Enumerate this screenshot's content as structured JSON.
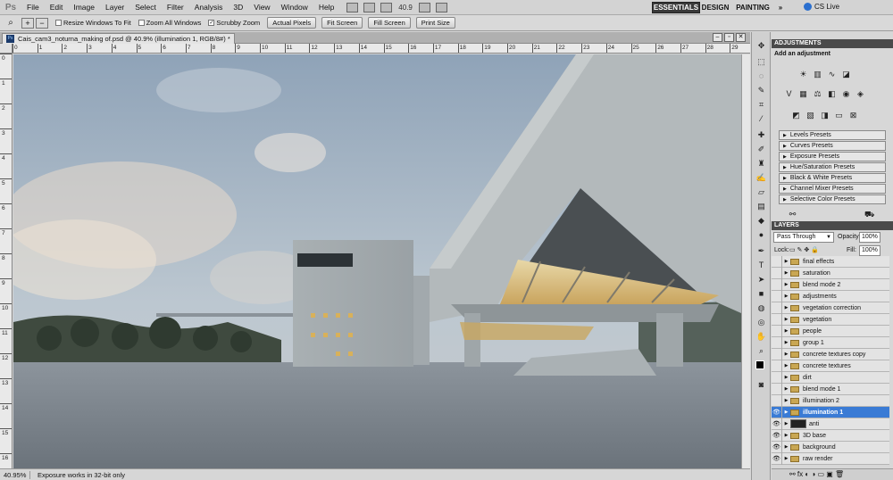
{
  "app": {
    "logo": "Ps"
  },
  "menu": [
    "File",
    "Edit",
    "Image",
    "Layer",
    "Select",
    "Filter",
    "Analysis",
    "3D",
    "View",
    "Window",
    "Help"
  ],
  "app_bar": {
    "zoom": "40.9",
    "workspaces": [
      "ESSENTIALS",
      "DESIGN",
      "PAINTING",
      "»"
    ],
    "cs_live": "CS Live"
  },
  "options": {
    "resize_windows": {
      "label": "Resize Windows To Fit",
      "checked": false
    },
    "zoom_all": {
      "label": "Zoom All Windows",
      "checked": false
    },
    "scrubby": {
      "label": "Scrubby Zoom",
      "checked": true
    },
    "buttons": [
      "Actual Pixels",
      "Fit Screen",
      "Fill Screen",
      "Print Size"
    ]
  },
  "document": {
    "tab_title": "Cais_cam3_noturna_making of.psd @ 40.9% (illumination 1, RGB/8#) *",
    "ruler_top": [
      "0",
      "1",
      "2",
      "3",
      "4",
      "5",
      "6",
      "7",
      "8",
      "9",
      "10",
      "11",
      "12",
      "13",
      "14",
      "15",
      "16",
      "17",
      "18",
      "19",
      "20",
      "21",
      "22",
      "23",
      "24",
      "25",
      "26",
      "27",
      "28",
      "29"
    ],
    "ruler_left": [
      "0",
      "1",
      "2",
      "3",
      "4",
      "5",
      "6",
      "7",
      "8",
      "9",
      "10",
      "11",
      "12",
      "13",
      "14",
      "15",
      "16"
    ]
  },
  "status": {
    "zoom": "40.95%",
    "message": "Exposure works in 32-bit only"
  },
  "adjustments": {
    "tab": "ADJUSTMENTS",
    "heading": "Add an adjustment",
    "presets": [
      "Levels Presets",
      "Curves Presets",
      "Exposure Presets",
      "Hue/Saturation Presets",
      "Black & White Presets",
      "Channel Mixer Presets",
      "Selective Color Presets"
    ]
  },
  "layers": {
    "tab": "LAYERS",
    "blend_mode": "Pass Through",
    "opacity_label": "Opacity:",
    "opacity": "100%",
    "lock_label": "Lock:",
    "fill_label": "Fill:",
    "fill": "100%",
    "items": [
      {
        "name": "final effects",
        "visible": false
      },
      {
        "name": "saturation",
        "visible": false
      },
      {
        "name": "blend mode 2",
        "visible": false
      },
      {
        "name": "adjustments",
        "visible": false
      },
      {
        "name": "vegetation correction",
        "visible": false
      },
      {
        "name": "vegetation",
        "visible": false
      },
      {
        "name": "people",
        "visible": false
      },
      {
        "name": "group 1",
        "visible": false
      },
      {
        "name": "concrete textures copy",
        "visible": false
      },
      {
        "name": "concrete textures",
        "visible": false
      },
      {
        "name": "dirt",
        "visible": false
      },
      {
        "name": "blend mode 1",
        "visible": false
      },
      {
        "name": "illumination 2",
        "visible": false
      },
      {
        "name": "illumination 1",
        "visible": true,
        "selected": true
      },
      {
        "name": "anti",
        "visible": true,
        "thumbnail": true
      },
      {
        "name": "3D base",
        "visible": true
      },
      {
        "name": "background",
        "visible": true
      },
      {
        "name": "raw render",
        "visible": true
      }
    ]
  },
  "colors": {
    "selection": "#3a7bd5",
    "workspace_active": "#3a3a3a",
    "panel_header": "#4a4a4a"
  }
}
